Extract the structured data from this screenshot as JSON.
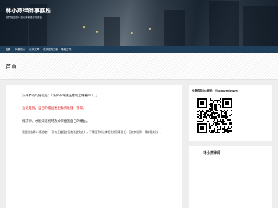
{
  "site": {
    "title": "林小燕律師事務所",
    "description": "我們相信法律 讓法律保護你的權益"
  },
  "nav": {
    "items": [
      {
        "label": "首頁"
      },
      {
        "label": "律師簡介"
      },
      {
        "label": "法律文章"
      },
      {
        "label": "法律諮詢方案"
      },
      {
        "label": "聯絡方式"
      }
    ]
  },
  "page": {
    "title": "首頁"
  },
  "content": {
    "p1": "法律界有句俗諺是：「法律不保護在權利上睡著的人。」",
    "p2": "台語是說，自己的權益要主動去維護、爭取。",
    "p3": "懂法律，才能知道何時及如何維護自己的權益。",
    "p4": "我國刑法第19條規定：「對有正當理由而無法避免者外，不得因不知法律而免除刑事責任。但按其情節，得減輕其刑。」"
  },
  "sidebar": {
    "qr_widget_title": "免費諮詢line帳號：@lulaoyenlawyer",
    "second_widget_title": "林小燕律師"
  },
  "colors": {
    "nav_background": "#1e3e5a",
    "highlight_red": "#e02424"
  },
  "icons": {
    "qr": "qr-code-image"
  }
}
